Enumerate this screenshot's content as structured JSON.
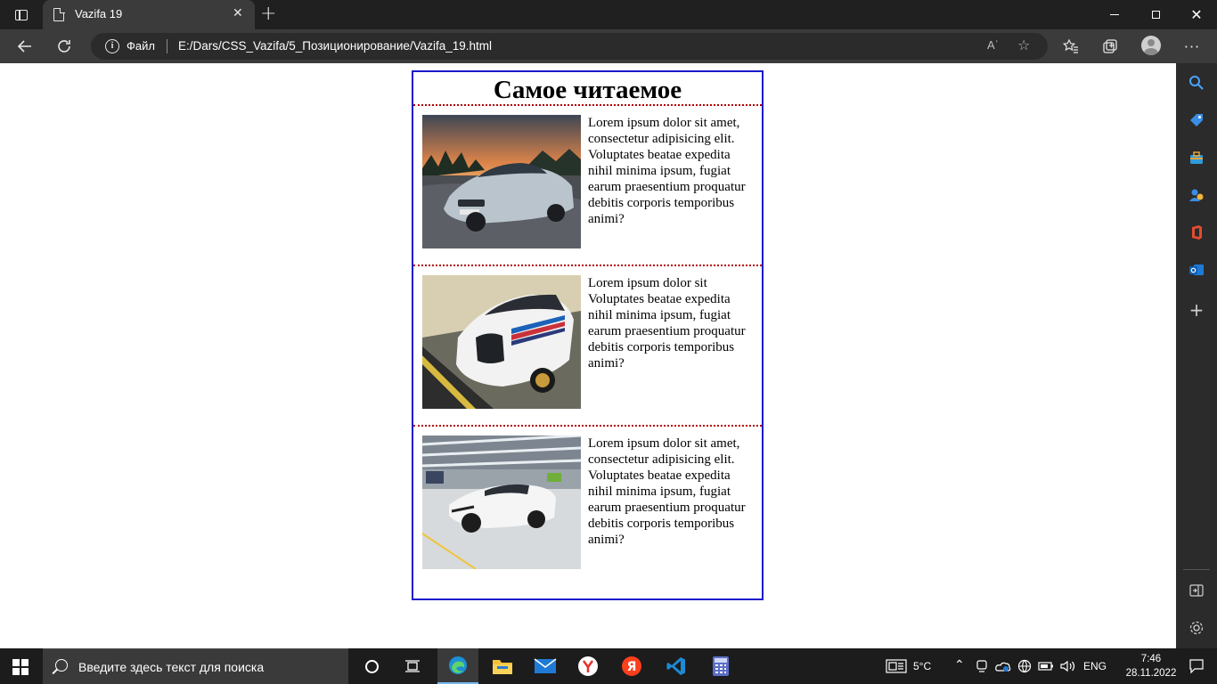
{
  "browser": {
    "tab_title": "Vazifa 19",
    "tab_close": "✕",
    "new_tab": "+",
    "window_close": "✕",
    "address_scheme": "Файл",
    "address_url": "E:/Dars/CSS_Vazifa/5_Позиционирование/Vazifa_19.html",
    "read_aloud": "Aʾ",
    "more": "···"
  },
  "page": {
    "heading": "Самое читаемое",
    "items": [
      {
        "text": "Lorem ipsum dolor sit amet, consectetur adipisicing elit. Voluptates beatae expedita nihil minima ipsum, fugiat earum praesentium proquatur debitis corporis temporibus animi?",
        "image": "bmw-m4-silver-sunset"
      },
      {
        "text": "Lorem ipsum dolor sit Voluptates beatae expedita nihil minima ipsum, fugiat earum praesentium proquatur debitis corporis temporibus animi?",
        "image": "bmw-3-0-csl-hommage-white"
      },
      {
        "text": "Lorem ipsum dolor sit amet, consectetur adipisicing elit. Voluptates beatae expedita nihil minima ipsum, fugiat earum praesentium proquatur debitis corporis temporibus animi?",
        "image": "lamborghini-huracan-white-factory"
      }
    ]
  },
  "taskbar": {
    "search_placeholder": "Введите здесь текст для поиска",
    "weather": "5°C",
    "language": "ENG",
    "time": "7:46",
    "date": "28.11.2022"
  },
  "colors": {
    "box_border": "#1a1acc",
    "dotted_separator": "#b30000",
    "titlebar": "#202020",
    "toolbar": "#3b3b3b",
    "taskbar": "#1c1c1c"
  }
}
